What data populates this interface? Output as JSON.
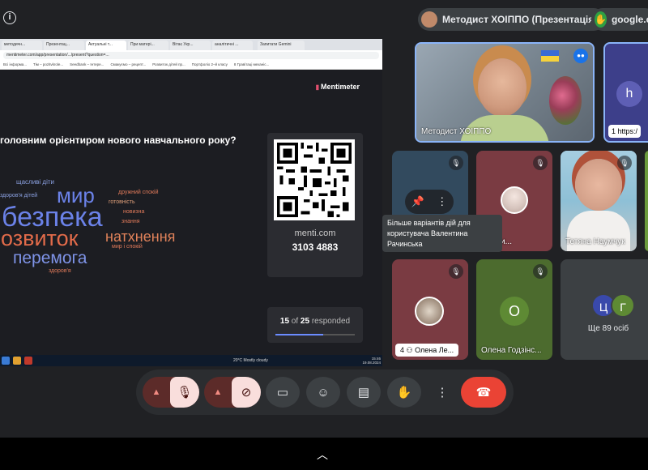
{
  "topbar": {
    "presenter_label": "Методист ХОІППО (Презентація)",
    "share_label": "google.co"
  },
  "browser": {
    "tabs": [
      "методичн...",
      "Презентац...",
      "Актуальні т...",
      "При матері...",
      "Вітає Укр...",
      "аналітичні ...",
      "Запитати Gemini"
    ],
    "url": "mentimeter.com/app/presentation/.../present?question=...",
    "bookmarks": [
      "Всі інформа...",
      "Тім – pozitvkrole...",
      "Seedbank – Інтере...",
      "Смакуємо – рецепт...",
      "Розвиток дітей пр...",
      "Портфоліо 2–й класу",
      "8 Гравітаці механіс..."
    ]
  },
  "slide": {
    "brand": "Mentimeter",
    "question": "головним орієнтиром нового навчального року?",
    "words": [
      {
        "text": "щасливі діти",
        "color": "#8aa0e0"
      },
      {
        "text": "мир",
        "color": "#6b82e8"
      },
      {
        "text": "дружний спокій",
        "color": "#e07a5a"
      },
      {
        "text": "здоров'я дітей",
        "color": "#8aa0e0"
      },
      {
        "text": "готовність",
        "color": "#e0a07a"
      },
      {
        "text": "безпека",
        "color": "#6b82e8"
      },
      {
        "text": "новизна",
        "color": "#e07a5a"
      },
      {
        "text": "знання",
        "color": "#e07a5a"
      },
      {
        "text": "розвиток",
        "color": "#e26b4a"
      },
      {
        "text": "натхнення",
        "color": "#e0825a"
      },
      {
        "text": "мир і спокій",
        "color": "#e07a5a"
      },
      {
        "text": "перемога",
        "color": "#7f94e8"
      },
      {
        "text": "здоров'я",
        "color": "#e07a5a"
      }
    ],
    "menti_url": "menti.com",
    "menti_code": "3103 4883",
    "responded_count": "15",
    "responded_of": "of",
    "responded_total": "25",
    "responded_suffix": "responded",
    "responded_fraction": 0.6
  },
  "taskbar": {
    "weather": "20°C Mostly cloudy",
    "clock_time": "15:46",
    "clock_date": "19.08.2024"
  },
  "participants": {
    "main_name": "Методист ХОІППО",
    "h_letter": "h",
    "h_chip": "1 https:/",
    "tooltip": "Більше варіантів дій для користувача Валентина Рачинська",
    "b_name": "Якими...",
    "c_name": "Тетяна Наумчук",
    "e_name": "Олена Ле...",
    "e_count": "4",
    "f_letter": "О",
    "f_name": "Олена Годзінс...",
    "more_a": "Ц",
    "more_b": "Г",
    "more_label": "Ще 89 осіб"
  },
  "colors": {
    "meet_bg": "#202124",
    "end_call": "#ea4335",
    "muted_bg": "#f9dedc"
  },
  "icons": {
    "info": "info-icon",
    "mic_off": "mic-off-icon",
    "camera_off": "camera-off-icon",
    "present": "present-screen-icon",
    "emoji": "emoji-icon",
    "captions": "captions-icon",
    "raise_hand": "raise-hand-icon",
    "more": "more-options-icon",
    "end_call": "end-call-icon",
    "pin": "pin-icon"
  }
}
